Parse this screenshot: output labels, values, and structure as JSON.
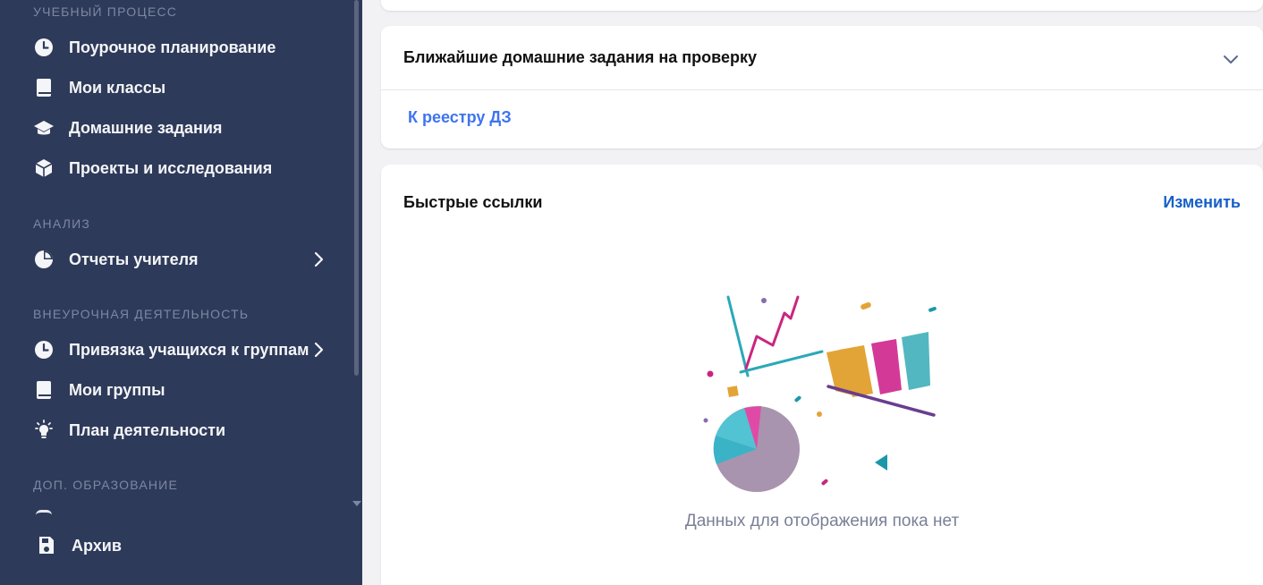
{
  "sidebar": {
    "sections": {
      "study": "УЧЕБНЫЙ ПРОЦЕСС",
      "analysis": "АНАЛИЗ",
      "extracurricular": "ВНЕУРОЧНАЯ ДЕЯТЕЛЬНОСТЬ",
      "additional": "ДОП. ОБРАЗОВАНИЕ"
    },
    "items": {
      "lesson_planning": "Поурочное планирование",
      "my_classes": "Мои классы",
      "homework": "Домашние задания",
      "projects": "Проекты и исследования",
      "teacher_reports": "Отчеты учителя",
      "student_groups": "Привязка учащихся к группам",
      "my_groups": "Мои группы",
      "activity_plan": "План деятельности",
      "archive": "Архив"
    }
  },
  "homework_card": {
    "title": "Ближайшие домашние задания на проверку",
    "link": "К реестру ДЗ"
  },
  "quick_links": {
    "title": "Быстрые ссылки",
    "edit": "Изменить",
    "empty": "Данных для отображения пока нет"
  },
  "colors": {
    "sidebar_bg": "#2e3a59",
    "link_blue": "#3f74f0",
    "edit_blue": "#1660c8"
  }
}
